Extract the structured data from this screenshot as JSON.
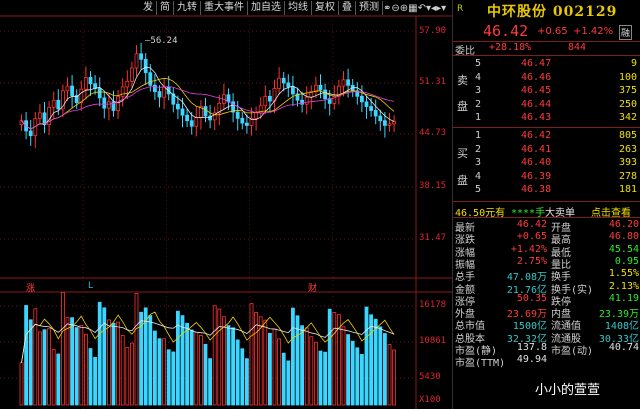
{
  "toolbar": {
    "buttons": [
      "发",
      "简",
      "九转",
      "重大事件",
      "加自选",
      "均线",
      "复权",
      "叠",
      "预测"
    ],
    "icons": [
      "bookmark-icon",
      "search-icon",
      "zoom-out-icon",
      "zoom-in-icon",
      "calendar-icon",
      "back-icon",
      "dropdown-icon"
    ],
    "glyphs": [
      "⚭",
      "⊖",
      "⊕",
      "▦",
      "↶",
      "▾",
      "▾"
    ],
    "last_label": "◂▸"
  },
  "chart": {
    "price_ticks": [
      "57.90",
      "51.31",
      "44.73",
      "38.15",
      "31.47"
    ],
    "high_marker": "56.24",
    "volume_ticks": [
      "16178",
      "10861",
      "5430",
      "X100"
    ],
    "markers": [
      {
        "label": "涨",
        "color": "#ff4040"
      },
      {
        "label": "L",
        "color": "#2bd"
      },
      {
        "label": "财",
        "color": "#ff4040"
      }
    ]
  },
  "quote": {
    "r_badge": "R",
    "name": "中环股份",
    "code": "002129",
    "price": "46.42",
    "change": "+0.65",
    "pct": "+1.42%",
    "tag": "融",
    "weibi_label": "委比",
    "weibi_value": "+28.18%",
    "weicha_value": "844",
    "sell_label": [
      "卖",
      "盘"
    ],
    "buy_label": [
      "买",
      "盘"
    ],
    "sell": [
      {
        "level": "5",
        "price": "46.47",
        "vol": "9"
      },
      {
        "level": "4",
        "price": "46.46",
        "vol": "100"
      },
      {
        "level": "3",
        "price": "46.45",
        "vol": "375"
      },
      {
        "level": "2",
        "price": "46.44",
        "vol": "250"
      },
      {
        "level": "1",
        "price": "46.43",
        "vol": "342"
      }
    ],
    "buy": [
      {
        "level": "1",
        "price": "46.42",
        "vol": "805"
      },
      {
        "level": "2",
        "price": "46.41",
        "vol": "263"
      },
      {
        "level": "3",
        "price": "46.40",
        "vol": "393"
      },
      {
        "level": "4",
        "price": "46.39",
        "vol": "278"
      },
      {
        "level": "5",
        "price": "46.38",
        "vol": "181"
      }
    ],
    "bar_line": {
      "price": "46.50元有",
      "stars": "****手",
      "big": "大卖单",
      "link": "点击查看"
    },
    "stats": [
      [
        "最新",
        "46.42",
        "开盘",
        "46.20"
      ],
      [
        "涨跌",
        "+0.65",
        "最高",
        "46.80"
      ],
      [
        "涨幅",
        "+1.42%",
        "最低",
        "45.54"
      ],
      [
        "振幅",
        "2.75%",
        "量比",
        "0.95"
      ],
      [
        "总手",
        "47.08万",
        "换手",
        "1.55%"
      ],
      [
        "金额",
        "21.76亿",
        "换手(实)",
        "2.13%"
      ],
      [
        "涨停",
        "50.35",
        "跌停",
        "41.19"
      ],
      [
        "外盘",
        "23.69万",
        "内盘",
        "23.39万"
      ],
      [
        "总市值",
        "1500亿",
        "流通值",
        "1408亿"
      ],
      [
        "总股本",
        "32.32亿",
        "流通股",
        "30.33亿"
      ],
      [
        "市盈(静)",
        "137.8",
        "市盈(动)",
        "40.74"
      ],
      [
        "市盈(TTM)",
        "49.94",
        "",
        ""
      ]
    ]
  },
  "watermark": "小小的萱萱"
}
